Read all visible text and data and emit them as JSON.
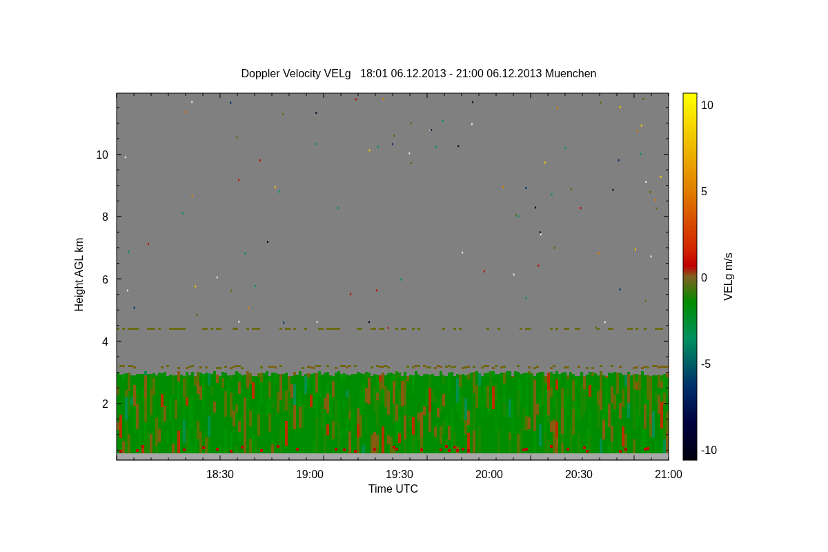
{
  "title": "Doppler Velocity VELg   18:01 06.12.2013 - 21:00 06.12.2013 Muenchen",
  "y_axis": {
    "label": "Height AGL km",
    "ticks": [
      "10",
      "8",
      "6",
      "4",
      "2"
    ]
  },
  "x_axis": {
    "label": "Time UTC",
    "ticks": [
      "18:30",
      "19:00",
      "19:30",
      "20:00",
      "20:30",
      "21:00"
    ]
  },
  "colorbar": {
    "label": "VELg m/s",
    "ticks": [
      "10",
      "5",
      "0",
      "-5",
      "-10"
    ]
  }
}
